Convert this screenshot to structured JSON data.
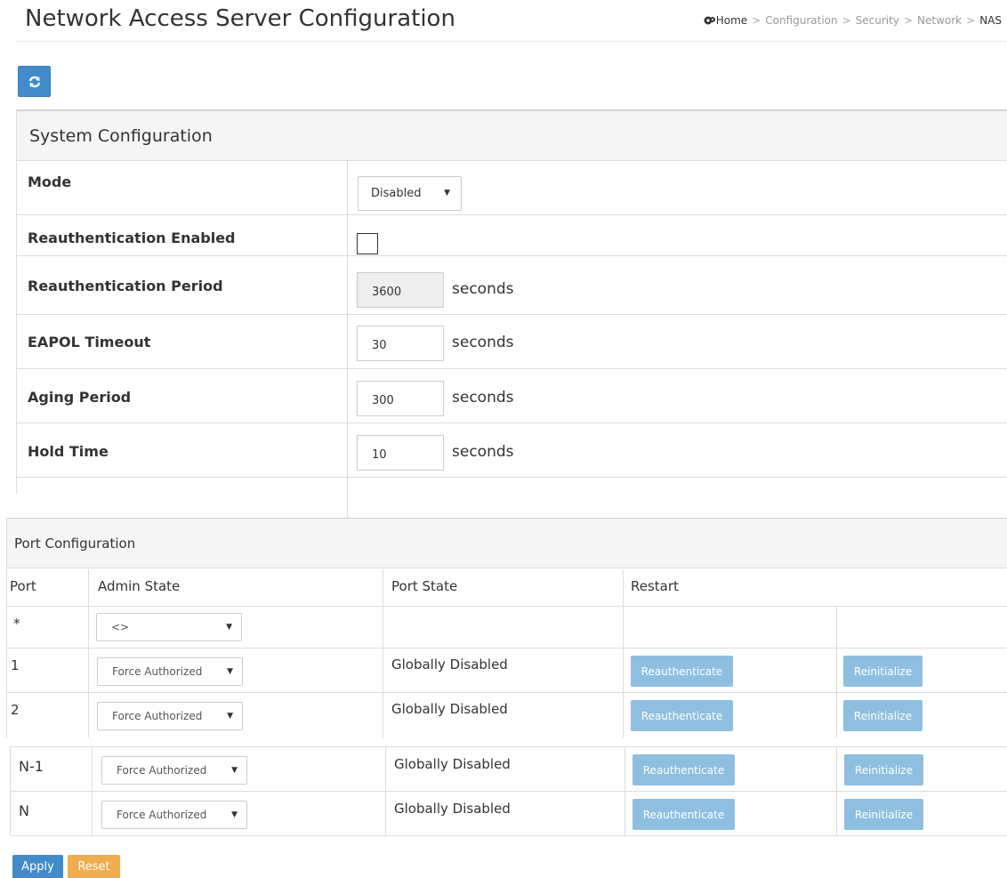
{
  "page": {
    "title": "Network Access Server Configuration"
  },
  "breadcrumb": {
    "home": "Home",
    "items": [
      "Configuration",
      "Security",
      "Network",
      "NAS"
    ],
    "separator": ">"
  },
  "toolbar": {
    "refresh_icon": "refresh-icon"
  },
  "system_config": {
    "title": "System Configuration",
    "rows": [
      {
        "label": "Mode",
        "value": "Disabled"
      },
      {
        "label": "Reauthentication Enabled",
        "checked": false
      },
      {
        "label": "Reauthentication Period",
        "value": "3600",
        "unit": "seconds",
        "disabled": true
      },
      {
        "label": "EAPOL Timeout",
        "value": "30",
        "unit": "seconds"
      },
      {
        "label": "Aging Period",
        "value": "300",
        "unit": "seconds"
      },
      {
        "label": "Hold Time",
        "value": "10",
        "unit": "seconds"
      }
    ]
  },
  "port_config": {
    "title": "Port Configuration",
    "headers": {
      "port": "Port",
      "admin_state": "Admin State",
      "port_state": "Port State",
      "restart": "Restart"
    },
    "rows": [
      {
        "port": "*",
        "admin_state": "<>",
        "port_state": ""
      },
      {
        "port": "1",
        "admin_state": "Force Authorized",
        "port_state": "Globally Disabled",
        "reauth": "Reauthenticate",
        "reinit": "Reinitialize"
      },
      {
        "port": "2",
        "admin_state": "Force Authorized",
        "port_state": "Globally Disabled",
        "reauth": "Reauthenticate",
        "reinit": "Reinitialize"
      },
      {
        "port": "N-1",
        "admin_state": "Force Authorized",
        "port_state": "Globally Disabled",
        "reauth": "Reauthenticate",
        "reinit": "Reinitialize"
      },
      {
        "port": "N",
        "admin_state": "Force Authorized",
        "port_state": "Globally Disabled",
        "reauth": "Reauthenticate",
        "reinit": "Reinitialize"
      }
    ]
  },
  "actions": {
    "apply": "Apply",
    "reset": "Reset"
  },
  "colors": {
    "primary": "#428bca",
    "button_light": "#8fbfe0",
    "warning": "#f0ad4e",
    "panel_header": "#f5f5f5",
    "border": "#dcdcdc"
  }
}
